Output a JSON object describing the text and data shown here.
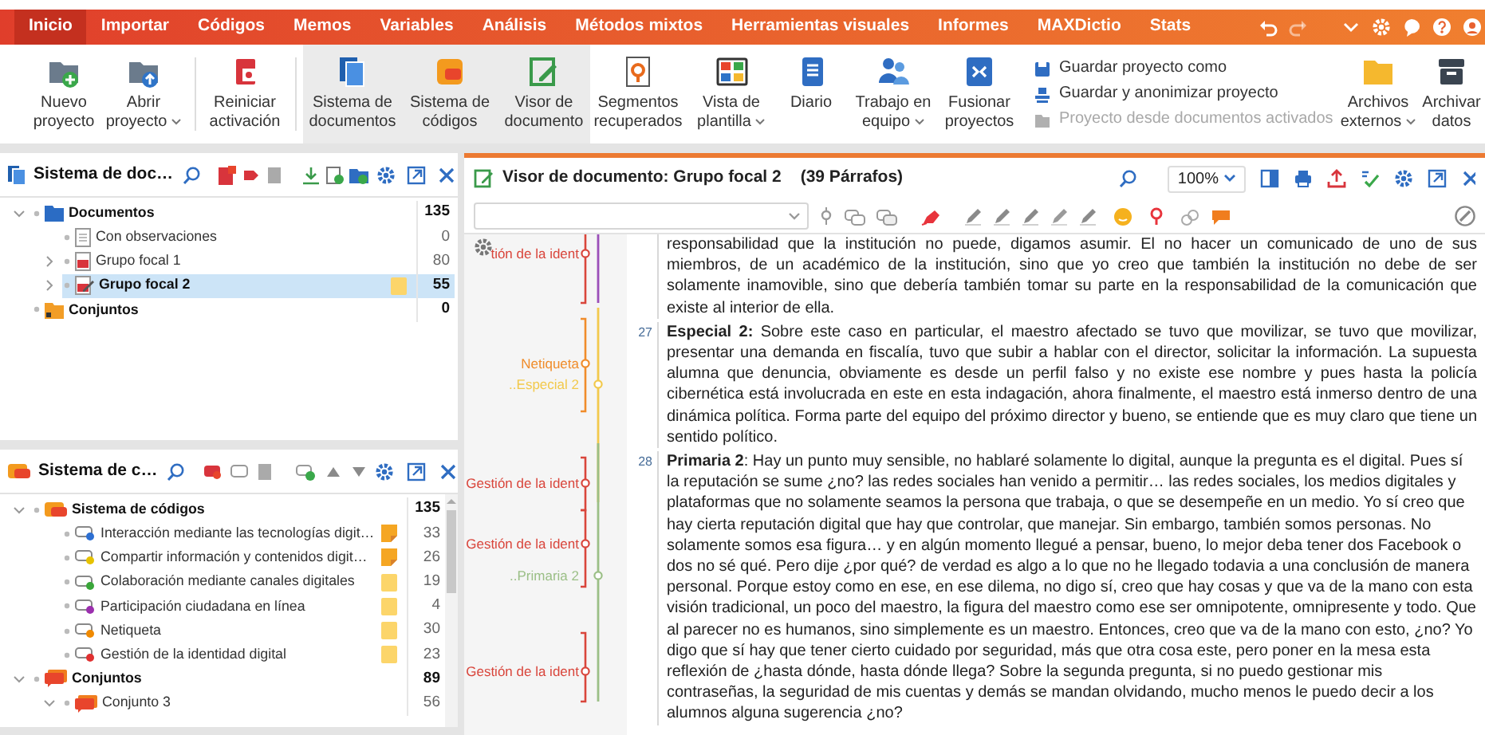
{
  "menu_tabs": [
    {
      "label": "Inicio",
      "selected": true
    },
    {
      "label": "Importar",
      "selected": false
    },
    {
      "label": "Códigos",
      "selected": false
    },
    {
      "label": "Memos",
      "selected": false
    },
    {
      "label": "Variables",
      "selected": false
    },
    {
      "label": "Análisis",
      "selected": false
    },
    {
      "label": "Métodos mixtos",
      "selected": false
    },
    {
      "label": "Herramientas visuales",
      "selected": false
    },
    {
      "label": "Informes",
      "selected": false
    },
    {
      "label": "MAXDictio",
      "selected": false
    },
    {
      "label": "Stats",
      "selected": false
    }
  ],
  "ribbon": [
    {
      "kind": "button",
      "lines": [
        "Nuevo",
        "proyecto"
      ],
      "dropdown": false,
      "active": false
    },
    {
      "kind": "button",
      "lines": [
        "Abrir",
        "proyecto"
      ],
      "dropdown": true,
      "active": false
    },
    {
      "kind": "button",
      "lines": [
        "Reiniciar",
        "activación"
      ],
      "dropdown": false,
      "active": false
    },
    {
      "kind": "button",
      "lines": [
        "Sistema de",
        "documentos"
      ],
      "dropdown": false,
      "active": true
    },
    {
      "kind": "button",
      "lines": [
        "Sistema de",
        "códigos"
      ],
      "dropdown": false,
      "active": true
    },
    {
      "kind": "button",
      "lines": [
        "Visor de",
        "documento"
      ],
      "dropdown": false,
      "active": true
    },
    {
      "kind": "button",
      "lines": [
        "Segmentos",
        "recuperados"
      ],
      "dropdown": false,
      "active": false
    },
    {
      "kind": "button",
      "lines": [
        "Vista de",
        "plantilla"
      ],
      "dropdown": true,
      "active": false
    },
    {
      "kind": "button",
      "lines": [
        "Diario"
      ],
      "dropdown": false,
      "active": false
    },
    {
      "kind": "button",
      "lines": [
        "Trabajo en",
        "equipo"
      ],
      "dropdown": true,
      "active": false
    },
    {
      "kind": "button",
      "lines": [
        "Fusionar",
        "proyectos"
      ],
      "dropdown": false,
      "active": false
    },
    {
      "kind": "links",
      "items": [
        {
          "label": "Guardar proyecto como",
          "disabled": false
        },
        {
          "label": "Guardar y anonimizar proyecto",
          "disabled": false
        },
        {
          "label": "Proyecto desde documentos activados",
          "disabled": true
        }
      ]
    },
    {
      "kind": "button",
      "lines": [
        "Archivos",
        "externos"
      ],
      "dropdown": true,
      "active": false
    },
    {
      "kind": "button",
      "lines": [
        "Archivar",
        "datos"
      ],
      "dropdown": false,
      "active": false
    }
  ],
  "document_system": {
    "title": "Sistema de doc…",
    "tree": [
      {
        "kind": "folder",
        "label": "Documentos",
        "count": "135",
        "expanded": true,
        "selected": false,
        "children": [
          {
            "kind": "document",
            "label": "Con observaciones",
            "count": "0",
            "selected": false
          },
          {
            "kind": "pdf",
            "label": "Grupo focal 1",
            "count": "80",
            "expanded": false,
            "selected": false
          },
          {
            "kind": "pdf-open",
            "label": "Grupo focal 2",
            "count": "55",
            "expanded": false,
            "selected": true,
            "memo": {
              "kind": "blank"
            }
          }
        ]
      },
      {
        "kind": "set",
        "label": "Conjuntos",
        "count": "0",
        "selected": false
      }
    ]
  },
  "code_system": {
    "title": "Sistema de c…",
    "tree": [
      {
        "kind": "code-system",
        "label": "Sistema de códigos",
        "count": "135",
        "expanded": true,
        "selected": false,
        "children": [
          {
            "kind": "code",
            "label": "Interacción mediante las tecnologías digit…",
            "color": "#2d6fd2",
            "memo": {
              "kind": "text"
            },
            "count": "33",
            "selected": false
          },
          {
            "kind": "code",
            "label": "Compartir información y contenidos digit…",
            "color": "#e6c200",
            "memo": {
              "kind": "text"
            },
            "count": "26",
            "selected": false
          },
          {
            "kind": "code",
            "label": "Colaboración mediante canales digitales",
            "color": "#3aa63a",
            "memo": {
              "kind": "blank"
            },
            "count": "19",
            "selected": false
          },
          {
            "kind": "code",
            "label": "Participación ciudadana en línea",
            "color": "#9b2fae",
            "memo": {
              "kind": "blank"
            },
            "count": "4",
            "selected": false
          },
          {
            "kind": "code",
            "label": "Netiqueta",
            "color": "#f08a00",
            "memo": {
              "kind": "blank"
            },
            "count": "30",
            "selected": false
          },
          {
            "kind": "code",
            "label": "Gestión de la identidad digital",
            "color": "#e03030",
            "memo": {
              "kind": "blank"
            },
            "count": "23",
            "selected": false
          }
        ]
      },
      {
        "kind": "code-set",
        "label": "Conjuntos",
        "count": "89",
        "expanded": true,
        "selected": false,
        "children": [
          {
            "kind": "code-set",
            "label": "Conjunto 3",
            "count": "56",
            "expanded": true,
            "selected": false
          }
        ]
      }
    ]
  },
  "document_viewer": {
    "title": "Visor de documento: Grupo focal 2",
    "paragraph_count": "(39 Párrafos)",
    "zoom": "100%",
    "code_margin": [
      {
        "kind": "bracket",
        "label": "tión de la ident",
        "color": "#d9453b"
      },
      {
        "kind": "line",
        "color": "#9b4fb8"
      },
      {
        "kind": "bracket",
        "label": "Netiqueta",
        "color": "#f08c2a"
      },
      {
        "kind": "line",
        "label": "..Especial 2",
        "color": "#f2c94c"
      },
      {
        "kind": "bracket",
        "label": "Gestión de la ident",
        "color": "#d9453b"
      },
      {
        "kind": "bracket",
        "label": "Gestión de la ident",
        "color": "#d9453b"
      },
      {
        "kind": "line",
        "label": "..Primaria 2",
        "color": "#9bbf86"
      },
      {
        "kind": "bracket",
        "label": "Gestión de la ident",
        "color": "#d9453b"
      }
    ],
    "paragraphs": [
      {
        "justified": true,
        "text": "responsabilidad que la institución no puede, digamos asumir. El no hacer un comunicado de uno de sus miembros, de un académico de la institución, sino que yo creo que también la institución no debe de ser solamente inamovible, sino que debería también tomar su parte en la responsabilidad de la comunicación que existe al interior de ella."
      },
      {
        "number": "27",
        "justified": true,
        "text": "**Especial 2:** Sobre este caso en particular, el maestro afectado se tuvo que movilizar, se tuvo que movilizar, presentar una demanda en fiscalía, tuvo que subir a hablar con el director, solicitar la información. La supuesta alumna que denuncia, obviamente es desde un perfil falso y no existe ese nombre y pues hasta la policía cibernética está involucrada en este en esta indagación, ahora finalmente, el maestro está inmerso dentro de una dinámica política. Forma parte del equipo del próximo director y bueno, se entiende que es muy claro que tiene un sentido político."
      },
      {
        "number": "28",
        "justified": false,
        "text": "**Primaria 2**: Hay un punto muy sensible, no hablaré solamente lo digital, aunque la pregunta es el digital. Pues sí la reputación se sume ¿no?  las redes sociales han venido a permitir… las redes sociales, los medios digitales y plataformas que no solamente seamos la persona que trabaja, o que se desempeñe en un medio. Yo sí creo que hay cierta reputación digital que hay que controlar, que manejar. Sin embargo, también somos personas. No solamente somos esa figura… y en algún momento llegué a pensar, bueno, lo mejor deba tener dos Facebook o dos no sé qué. Pero dije ¿por qué? de verdad es algo a lo que no he llegado todavia a una conclusión de manera personal. Porque estoy como en ese, en ese dilema, no digo sí, creo que hay cosas y que va de la mano con esta visión tradicional, un poco del maestro, la figura del maestro como ese ser omnipotente, omnipresente y todo. Que al parecer no es humanos, sino simplemente es un maestro. Entonces, creo que va de la mano con esto, ¿no? Yo digo que sí hay que tener cierto cuidado por seguridad, más que otra cosa este, pero poner en la mesa esta reflexión de ¿hasta dónde, hasta dónde llega?  Sobre la segunda pregunta, si no puedo gestionar mis contraseñas, la seguridad de mis cuentas y demás se mandan olvidando, mucho menos le puedo decir a los alumnos alguna sugerencia ¿no?"
      }
    ]
  }
}
